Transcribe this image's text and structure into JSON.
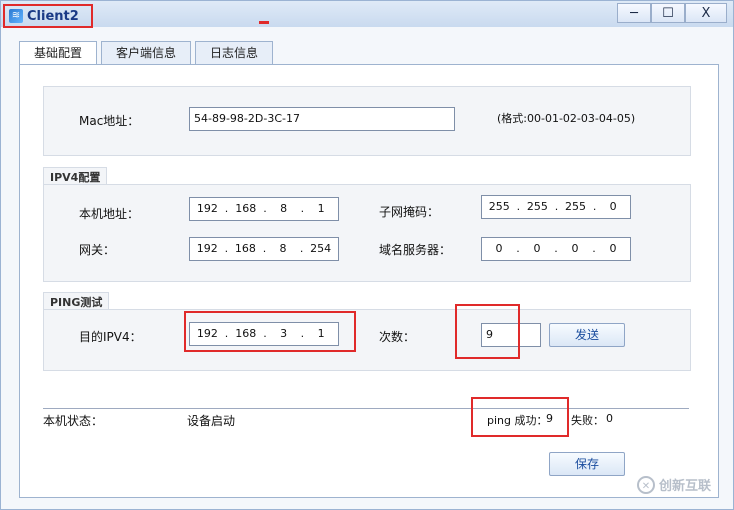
{
  "window": {
    "title": "Client2",
    "controls": {
      "minimize": "─",
      "maximize": "☐",
      "close": "X"
    }
  },
  "tabs": [
    {
      "label": "基础配置",
      "active": true
    },
    {
      "label": "客户端信息",
      "active": false
    },
    {
      "label": "日志信息",
      "active": false
    }
  ],
  "mac": {
    "label": "Mac地址：",
    "value": "54-89-98-2D-3C-17",
    "hint": "(格式:00-01-02-03-04-05)"
  },
  "ipv4": {
    "group_label": "IPV4配置",
    "host_label": "本机地址：",
    "host": [
      "192",
      "168",
      "8",
      "1"
    ],
    "mask_label": "子网掩码：",
    "mask": [
      "255",
      "255",
      "255",
      "0"
    ],
    "gateway_label": "网关：",
    "gateway": [
      "192",
      "168",
      "8",
      "254"
    ],
    "dns_label": "域名服务器：",
    "dns": [
      "0",
      "0",
      "0",
      "0"
    ]
  },
  "ping": {
    "group_label": "PING测试",
    "dest_label": "目的IPV4：",
    "dest": [
      "192",
      "168",
      "3",
      "1"
    ],
    "count_label": "次数：",
    "count": "9",
    "send_label": "发送"
  },
  "status": {
    "label": "本机状态：",
    "value": "设备启动",
    "success_label": "ping 成功：",
    "success_value": "9",
    "fail_label": "失败：",
    "fail_value": "0"
  },
  "save_label": "保存",
  "watermark": {
    "text": "创新互联"
  },
  "colors": {
    "highlight": "#e02a2a",
    "accent": "#1b4d9e"
  }
}
